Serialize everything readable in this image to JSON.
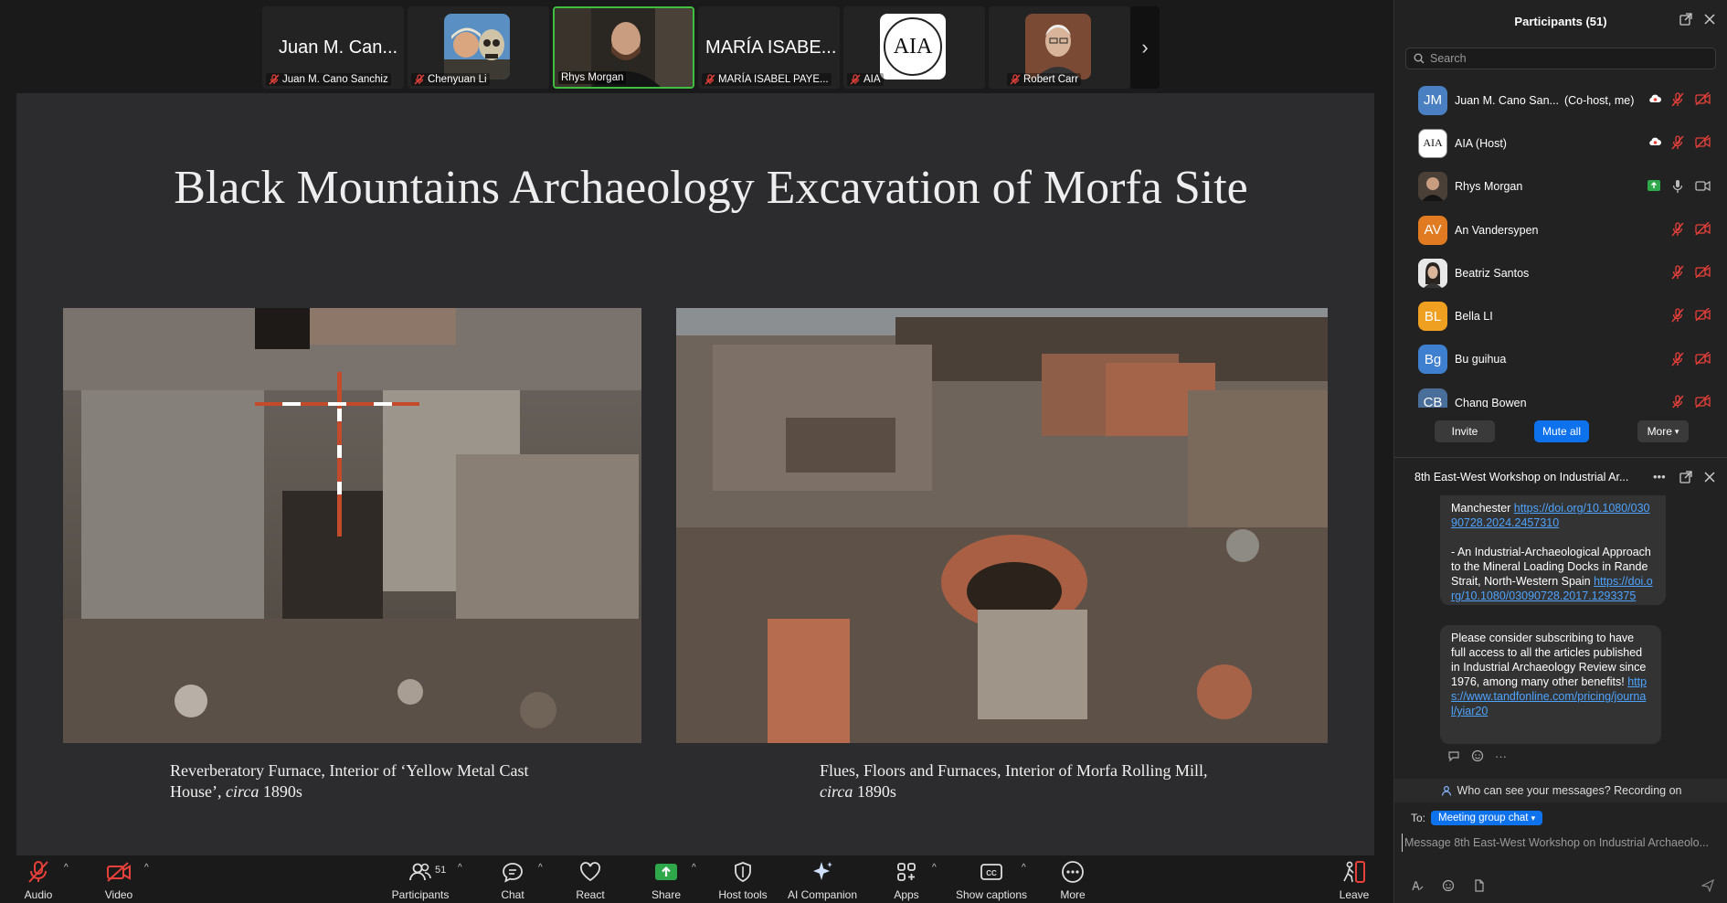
{
  "filmstrip": {
    "tiles": [
      {
        "big_name": "Juan M. Can...",
        "label": "Juan M. Cano Sanchiz"
      },
      {
        "label": "Chenyuan Li"
      },
      {
        "label": "Rhys Morgan"
      },
      {
        "big_name": "MARÍA ISABE...",
        "label": "MARÍA ISABEL PAYE..."
      },
      {
        "label": "AIA",
        "logo_text": "AIA"
      },
      {
        "label": "Robert Carr"
      }
    ]
  },
  "slide": {
    "title": "Black Mountains Archaeology Excavation of Morfa Site",
    "caption_left_a": "Reverberatory Furnace, Interior of ‘Yellow Metal Cast House’, ",
    "caption_left_em": "circa",
    "caption_left_b": " 1890s",
    "caption_right_a": "Flues, Floors and Furnaces, Interior of Morfa Rolling Mill, ",
    "caption_right_em": "circa",
    "caption_right_b": " 1890s"
  },
  "toolbar": {
    "audio": "Audio",
    "video": "Video",
    "participants": "Participants",
    "participants_count": "51",
    "chat": "Chat",
    "react": "React",
    "share": "Share",
    "host_tools": "Host tools",
    "ai_companion": "AI Companion",
    "apps": "Apps",
    "show_captions": "Show captions",
    "more": "More",
    "leave": "Leave"
  },
  "participants_panel": {
    "title": "Participants (51)",
    "search_placeholder": "Search",
    "list": [
      {
        "initials": "JM",
        "name": "Juan M. Cano San...",
        "role": "(Co-host, me)",
        "color": "#4a7fc1"
      },
      {
        "initials": "AIA",
        "name": "AIA (Host)",
        "role": "",
        "color": "#ffffff"
      },
      {
        "initials": "",
        "name": "Rhys Morgan",
        "role": "",
        "color": "#555555"
      },
      {
        "initials": "AV",
        "name": "An Vandersypen",
        "role": "",
        "color": "#e07b22"
      },
      {
        "initials": "",
        "name": "Beatriz Santos",
        "role": "",
        "color": "#dddddd"
      },
      {
        "initials": "BL",
        "name": "Bella LI",
        "role": "",
        "color": "#f0a020"
      },
      {
        "initials": "Bg",
        "name": "Bu guihua",
        "role": "",
        "color": "#3f7fd0"
      },
      {
        "initials": "CB",
        "name": "Chang Bowen",
        "role": "",
        "color": "#4a6e9a"
      }
    ],
    "invite": "Invite",
    "mute_all": "Mute all",
    "more": "More"
  },
  "chat_panel": {
    "title": "8th East-West Workshop on Industrial Ar...",
    "bubble1_text1": "Manchester ",
    "bubble1_link1": "https://doi.org/10.1080/03090728.2024.2457310",
    "bubble1_text2": "- An Industrial-Archaeological Approach to the Mineral Loading Docks in Rande Strait, North-Western Spain ",
    "bubble1_link2": "https://doi.org/10.1080/03090728.2017.1293375",
    "bubble2_text": "Please consider subscribing to have full access to all the articles published in Industrial Archaeology Review since 1976, among many other benefits! ",
    "bubble2_link": "https://www.tandfonline.com/pricing/journal/yiar20",
    "visibility": "Who can see your messages? Recording on",
    "to_label": "To:",
    "to_value": "Meeting group chat",
    "input_placeholder": "Message 8th East-West Workshop on Industrial Archaeolo..."
  },
  "colors": {
    "accent": "#0e72ed",
    "muted_red": "#e8403a",
    "active_speaker": "#3fbf3f",
    "link": "#4da3ff"
  }
}
